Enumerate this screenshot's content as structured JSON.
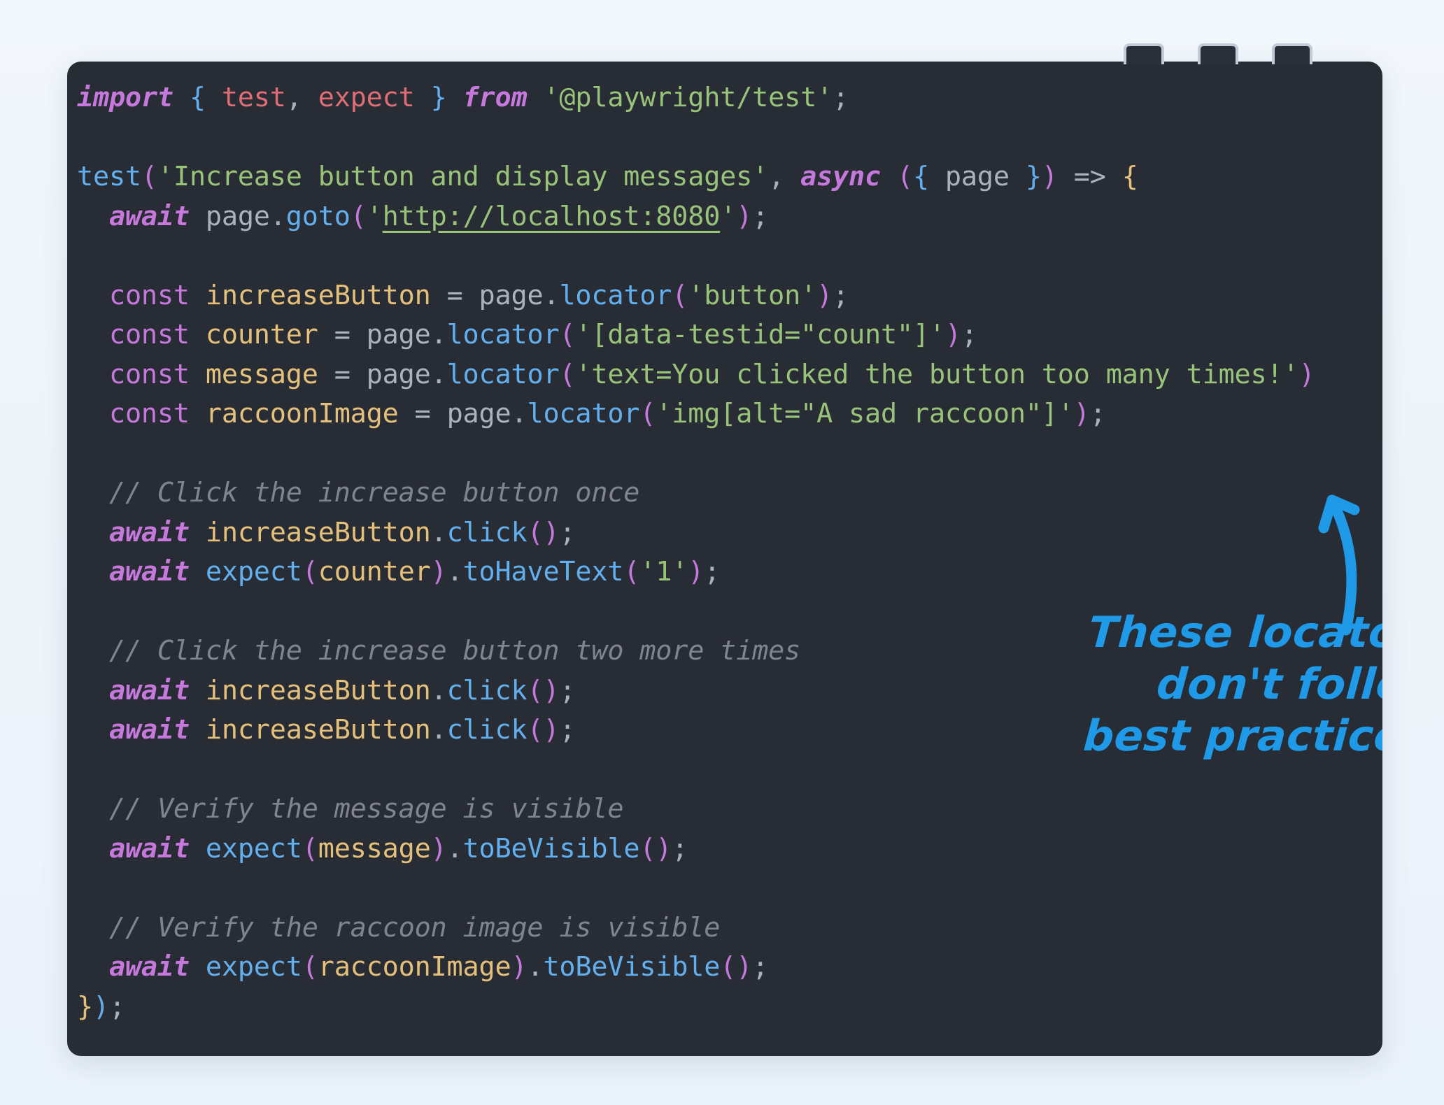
{
  "window": {
    "controls": [
      {
        "name": "minimize-button"
      },
      {
        "name": "maximize-button"
      },
      {
        "name": "close-button"
      }
    ]
  },
  "theme": {
    "page_background": "#eef4fa",
    "panel_background": "#282c34",
    "keyword": "#c678dd",
    "import_name": "#e06c75",
    "function": "#61afef",
    "string": "#98c379",
    "variable": "#e5c07b",
    "plain": "#abb2bf",
    "comment": "#7f848e",
    "annotation": "#1e9ae8"
  },
  "editor": {
    "language": "typescript",
    "file_kind": "playwright-test",
    "code_lines": [
      "import { test, expect } from '@playwright/test';",
      "",
      "test('Increase button and display messages', async ({ page }) => {",
      "  await page.goto('http://localhost:8080');",
      "",
      "  const increaseButton = page.locator('button');",
      "  const counter = page.locator('[data-testid=\"count\"]');",
      "  const message = page.locator('text=You clicked the button too many times!')",
      "  const raccoonImage = page.locator('img[alt=\"A sad raccoon\"]');",
      "",
      "  // Click the increase button once",
      "  await increaseButton.click();",
      "  await expect(counter).toHaveText('1');",
      "",
      "  // Click the increase button two more times",
      "  await increaseButton.click();",
      "  await increaseButton.click();",
      "",
      "  // Verify the message is visible",
      "  await expect(message).toBeVisible();",
      "",
      "  // Verify the raccoon image is visible",
      "  await expect(raccoonImage).toBeVisible();",
      "});"
    ],
    "tokens": {
      "import_kw": "import",
      "from_kw": "from",
      "async_kw": "async",
      "await_kw": "await",
      "const_kw": "const",
      "test_fn": "test",
      "expect_fn": "expect",
      "package": "'@playwright/test';",
      "test_title": "'Increase button and display messages'",
      "url": "http://localhost:8080",
      "selector_button": "'button'",
      "selector_count": "'[data-testid=\"count\"]'",
      "selector_message": "'text=You clicked the button too many times!'",
      "selector_raccoon": "'img[alt=\"A sad raccoon\"]'",
      "expected_count": "'1'"
    },
    "comments": [
      "// Click the increase button once",
      "// Click the increase button two more times",
      "// Verify the message is visible",
      "// Verify the raccoon image is visible"
    ],
    "variables": [
      "increaseButton",
      "counter",
      "message",
      "raccoonImage",
      "page"
    ],
    "methods": [
      "goto",
      "locator",
      "click",
      "toHaveText",
      "toBeVisible"
    ]
  },
  "annotation": {
    "line1": "These locators",
    "line2": "don't follow",
    "line3": "best practices.",
    "arrow": "curved-arrow-up-left",
    "color": "#1e9ae8"
  }
}
